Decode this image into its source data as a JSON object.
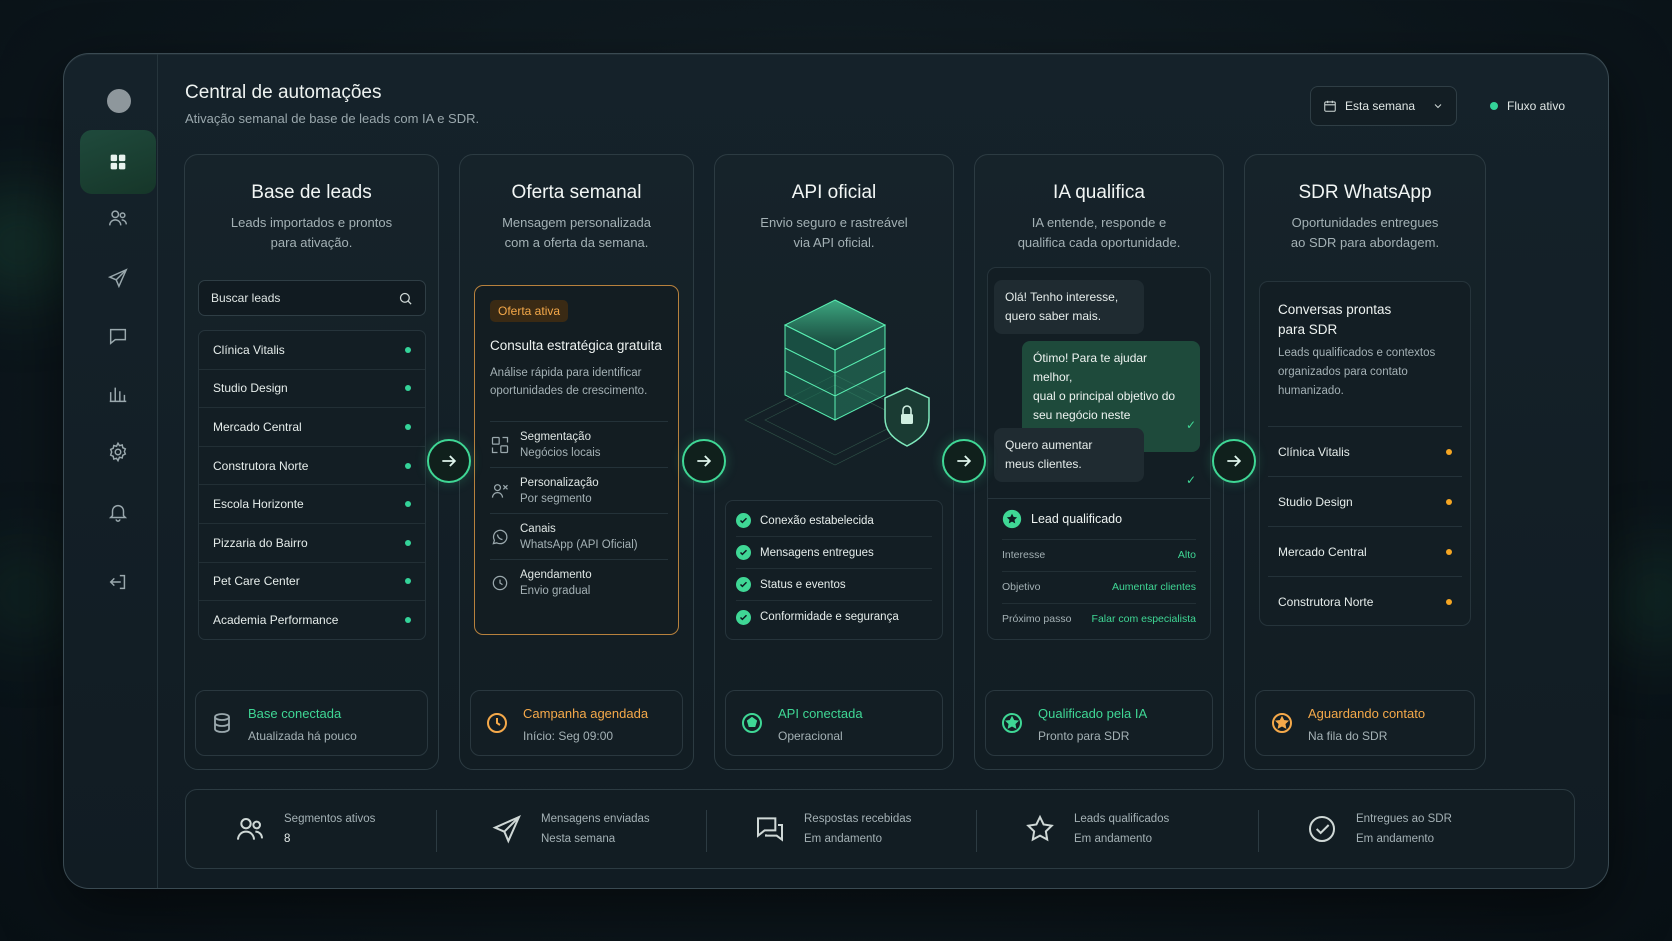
{
  "header": {
    "title": "Central de automações",
    "subtitle": "Ativação semanal de base de leads com IA e SDR.",
    "week_label": "Esta semana",
    "flow_status": "Fluxo ativo"
  },
  "sidebar": {
    "items": [
      {
        "icon": "grid-icon",
        "active": true
      },
      {
        "icon": "users-icon"
      },
      {
        "icon": "send-icon"
      },
      {
        "icon": "chat-icon"
      },
      {
        "icon": "chart-icon"
      },
      {
        "icon": "gear-icon"
      },
      {
        "icon": "bell-icon"
      },
      {
        "icon": "logout-icon"
      }
    ]
  },
  "columns": {
    "leads": {
      "title": "Base de leads",
      "desc": "Leads importados e prontos\npara ativação.",
      "search_placeholder": "Buscar leads",
      "items": [
        "Clínica Vitalis",
        "Studio Design",
        "Mercado Central",
        "Construtora Norte",
        "Escola Horizonte",
        "Pizzaria do Bairro",
        "Pet Care Center",
        "Academia Performance"
      ],
      "footer_title": "Base conectada",
      "footer_sub": "Atualizada há pouco"
    },
    "offer": {
      "title": "Oferta semanal",
      "desc": "Mensagem personalizada\ncom a oferta da semana.",
      "badge": "Oferta ativa",
      "card_title": "Consulta estratégica gratuita",
      "card_desc": "Análise rápida para identificar oportunidades de crescimento.",
      "features": [
        {
          "label": "Segmentação",
          "value": "Negócios locais",
          "icon": "segment-icon"
        },
        {
          "label": "Personalização",
          "value": "Por segmento",
          "icon": "persona-icon"
        },
        {
          "label": "Canais",
          "value": "WhatsApp (API Oficial)",
          "icon": "whatsapp-icon"
        },
        {
          "label": "Agendamento",
          "value": "Envio gradual",
          "icon": "schedule-icon"
        }
      ],
      "footer_title": "Campanha agendada",
      "footer_sub": "Início: Seg 09:00"
    },
    "api": {
      "title": "API oficial",
      "desc": "Envio seguro e rastreável\nvia API oficial.",
      "checks": [
        "Conexão estabelecida",
        "Mensagens entregues",
        "Status e eventos",
        "Conformidade e segurança"
      ],
      "footer_title": "API conectada",
      "footer_sub": "Operacional"
    },
    "ia": {
      "title": "IA qualifica",
      "desc": "IA entende, responde e\nqualifica cada oportunidade.",
      "msg1": "Olá! Tenho interesse,\nquero saber mais.",
      "msg2": "Ótimo! Para te ajudar melhor,\nqual o principal objetivo do\nseu negócio neste momento?",
      "msg3": "Quero aumentar\nmeus clientes.",
      "qual_title": "Lead qualificado",
      "qual_rows": [
        {
          "label": "Interesse",
          "value": "Alto"
        },
        {
          "label": "Objetivo",
          "value": "Aumentar clientes"
        },
        {
          "label": "Próximo passo",
          "value": "Falar com especialista"
        }
      ],
      "footer_title": "Qualificado pela IA",
      "footer_sub": "Pronto para SDR"
    },
    "sdr": {
      "title": "SDR WhatsApp",
      "desc": "Oportunidades entregues\nao SDR para abordagem.",
      "box_title": "Conversas prontas\npara SDR",
      "box_desc": "Leads qualificados e contextos organizados para contato humanizado.",
      "items": [
        "Clínica Vitalis",
        "Studio Design",
        "Mercado Central",
        "Construtora Norte"
      ],
      "footer_title": "Aguardando contato",
      "footer_sub": "Na fila do SDR"
    }
  },
  "stats": [
    {
      "label": "Segmentos ativos",
      "value": "8",
      "icon": "users-icon"
    },
    {
      "label": "Mensagens enviadas",
      "value": "Nesta semana",
      "icon": "send-icon"
    },
    {
      "label": "Respostas recebidas",
      "value": "Em andamento",
      "icon": "chat-icon"
    },
    {
      "label": "Leads qualificados",
      "value": "Em andamento",
      "icon": "star-icon"
    },
    {
      "label": "Entregues ao SDR",
      "value": "Em andamento",
      "icon": "check-circle-icon"
    }
  ],
  "colors": {
    "accent": "#3fd795",
    "warning": "#f5a94a",
    "bg": "#111c23"
  }
}
